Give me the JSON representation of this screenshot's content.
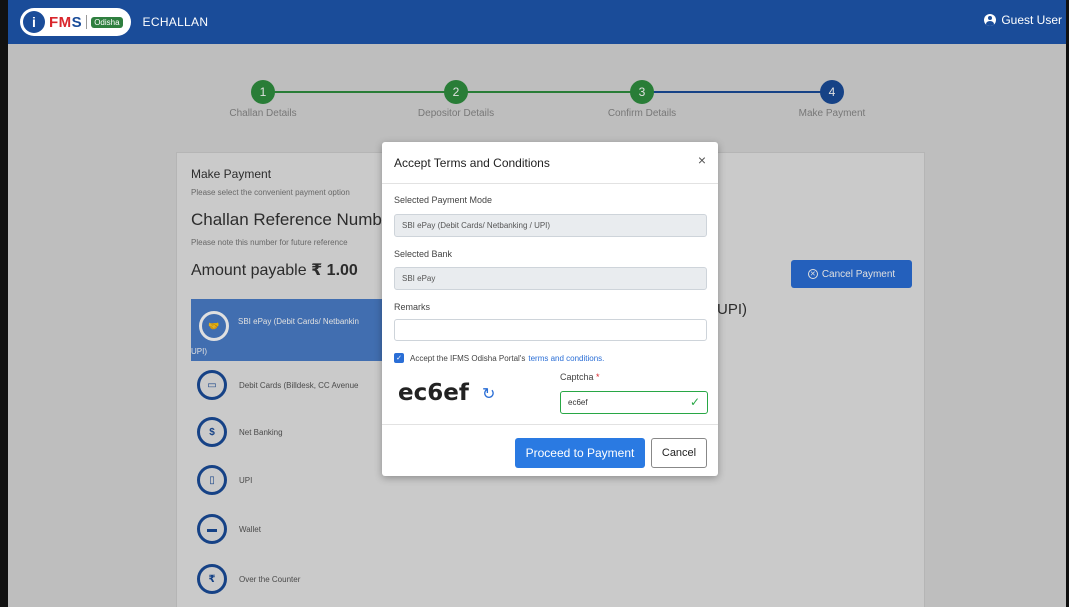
{
  "navbar": {
    "logo_i": "i",
    "logo_fms_f": "F",
    "logo_fms_m": "M",
    "logo_fms_s": "S",
    "logo_odisha": "Odisha",
    "app_name": "ECHALLAN",
    "user_label": "Guest User"
  },
  "stepper": {
    "steps": [
      {
        "number": "1",
        "label": "Challan Details",
        "status": "done"
      },
      {
        "number": "2",
        "label": "Depositor Details",
        "status": "done"
      },
      {
        "number": "3",
        "label": "Confirm Details",
        "status": "done"
      },
      {
        "number": "4",
        "label": "Make Payment",
        "status": "current"
      }
    ],
    "colors": {
      "done": "#2f8f3f",
      "current": "#1a4c99"
    }
  },
  "card": {
    "title": "Make Payment",
    "subtitle": "Please select the convenient payment option",
    "reference_label": "Challan Reference Numbe",
    "reference_note": "Please note this number for future reference",
    "amount_label": "Amount payable",
    "amount_value": "₹ 1.00",
    "cancel_payment_label": "Cancel Payment",
    "upi_suffix": "UPI)",
    "options": [
      {
        "label": "SBI ePay (Debit Cards/ Netbanking / UPI)",
        "label_line1": "SBI ePay (Debit Cards/ Netbankin",
        "label_line2": "UPI)",
        "icon": "handshake-icon",
        "glyph": "🤝",
        "active": true
      },
      {
        "label": "Debit Cards (Billdesk, CC Avenue",
        "icon": "card-icon",
        "glyph": "▭",
        "active": false
      },
      {
        "label": "Net Banking",
        "icon": "netbanking-icon",
        "glyph": "$",
        "active": false
      },
      {
        "label": "UPI",
        "icon": "mobile-icon",
        "glyph": "▯",
        "active": false
      },
      {
        "label": "Wallet",
        "icon": "wallet-icon",
        "glyph": "▬",
        "active": false
      },
      {
        "label": "Over the Counter",
        "icon": "rupee-icon",
        "glyph": "₹",
        "active": false
      }
    ]
  },
  "modal": {
    "title": "Accept Terms and Conditions",
    "close_glyph": "×",
    "payment_mode_label": "Selected Payment Mode",
    "payment_mode_value": "SBI ePay (Debit Cards/ Netbanking / UPI)",
    "bank_label": "Selected Bank",
    "bank_value": "SBI ePay",
    "remarks_label": "Remarks",
    "remarks_value": "",
    "accept_text": "Accept the IFMS Odisha Portal's",
    "terms_link": "terms and conditions.",
    "captcha_image_text": "ec6ef",
    "captcha_label": "Captcha",
    "captcha_required": "*",
    "captcha_value": "ec6ef",
    "proceed_label": "Proceed to Payment",
    "cancel_label": "Cancel"
  }
}
